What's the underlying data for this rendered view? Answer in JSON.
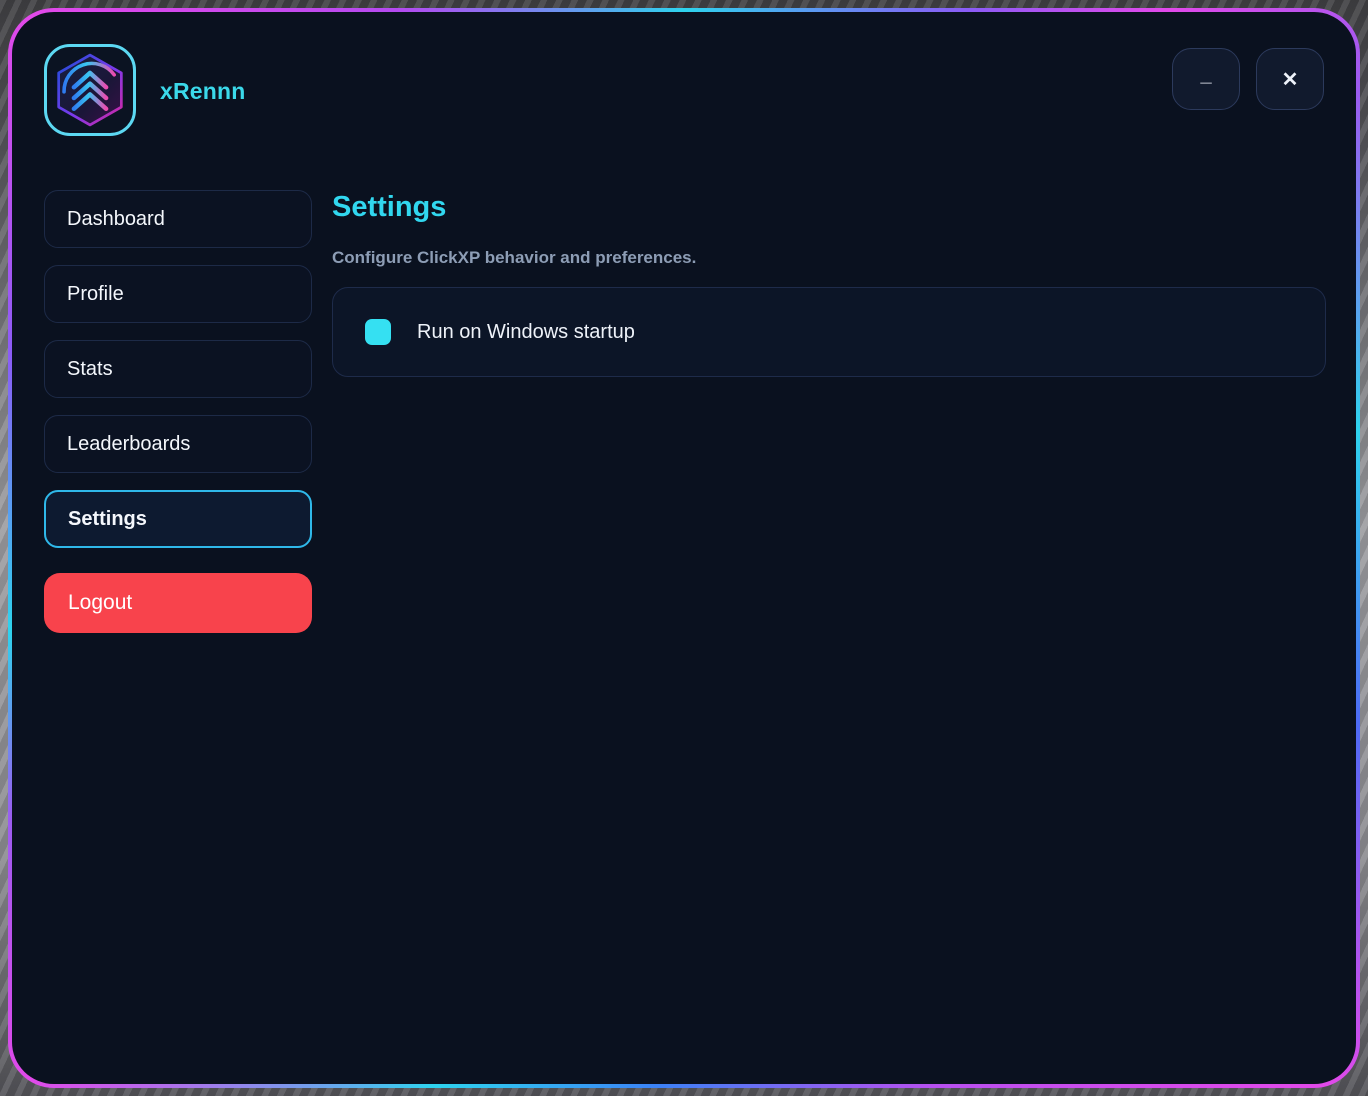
{
  "app": {
    "name": "xRennn"
  },
  "window_controls": {
    "minimize_label": "_",
    "close_label": "✕"
  },
  "sidebar": {
    "items": [
      {
        "label": "Dashboard",
        "active": false
      },
      {
        "label": "Profile",
        "active": false
      },
      {
        "label": "Stats",
        "active": false
      },
      {
        "label": "Leaderboards",
        "active": false
      },
      {
        "label": "Settings",
        "active": true
      }
    ],
    "logout_label": "Logout"
  },
  "main": {
    "title": "Settings",
    "subtitle": "Configure ClickXP behavior and preferences.",
    "options": [
      {
        "label": "Run on Windows startup",
        "checked": true
      }
    ]
  },
  "colors": {
    "accent_cyan": "#31d7ef",
    "checkbox_cyan": "#35e0f2",
    "logout_red": "#f8434c",
    "window_bg": "#0a111f",
    "frame_gradient": [
      "#e249ea",
      "#8b5cf6",
      "#3b82f6",
      "#2ed3ee"
    ]
  }
}
